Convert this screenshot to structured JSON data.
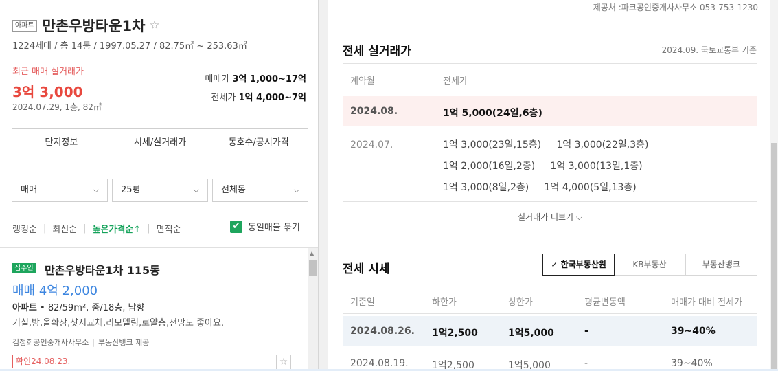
{
  "complex": {
    "tag": "아파트",
    "name": "만촌우방타운1차",
    "star": "☆",
    "summary": "1224세대 / 총 14동 / 1997.05.27 / 82.75㎡ ~ 253.63㎡",
    "recent_label": "최근 매매 실거래가",
    "recent_price": "3억 3,000",
    "recent_date": "2024.07.29, 1층, 82㎡",
    "sale_range_label": "매매가",
    "sale_range": "3억 1,000~17억",
    "jeonse_range_label": "전세가",
    "jeonse_range": "1억 4,000~7억"
  },
  "info_tabs": [
    "단지정보",
    "시세/실거래가",
    "동호수/공시가격"
  ],
  "filters": {
    "trade_type": "매매",
    "size": "25평",
    "dong": "전체동",
    "chevron": "⌵"
  },
  "sort": {
    "items": [
      "랭킹순",
      "최신순",
      "높은가격순↑",
      "면적순"
    ],
    "active_index": 2,
    "group_label": "동일매물 묶기",
    "group_checked": true,
    "check_mark": "✔"
  },
  "listing": {
    "badge": "집주인",
    "title": "만촌우방타운1차 115동",
    "price": "매매 4억 2,000",
    "type": "아파트",
    "info": "82/59m², 중/18층, 남향",
    "desc": "거실,방,올확장,샷시교체,리모델링,로얄층,전망도 좋아요.",
    "agent": "김정희공인중개사사무소",
    "source": "부동산뱅크 제공",
    "confirm": "확인24.08.23.",
    "fav": "☆"
  },
  "provider": "제공처 :파크공인중개사사무소 053-753-1230",
  "real_trades": {
    "title": "전세 실거래가",
    "note": "2024.09. 국토교통부 기준",
    "col_month": "계약월",
    "col_price": "전세가",
    "highlight": {
      "month": "2024.08.",
      "value": "1억 5,000(24일,6층)"
    },
    "month2": "2024.07.",
    "lines": [
      "1억 3,000(23일,15층)     1억 3,000(22일,3층)",
      "1억 2,000(16일,2층)     1억 3,000(13일,1층)",
      "1억 3,000(8일,2층)     1억 4,000(5일,13층)"
    ],
    "more": "실거래가 더보기 ⌵"
  },
  "market": {
    "title": "전세 시세",
    "tabs": [
      "✓ 한국부동산원",
      "KB부동산",
      "부동산뱅크"
    ],
    "active_tab": 0,
    "headers": [
      "기준일",
      "하한가",
      "상한가",
      "평균변동액",
      "매매가 대비 전세가"
    ],
    "rows": [
      {
        "date": "2024.08.26.",
        "low": "1억2,500",
        "high": "1억5,000",
        "change": "-",
        "ratio": "39~40%"
      },
      {
        "date": "2024.08.19.",
        "low": "1억2,500",
        "high": "1억5,000",
        "change": "-",
        "ratio": "39~40%"
      }
    ]
  }
}
